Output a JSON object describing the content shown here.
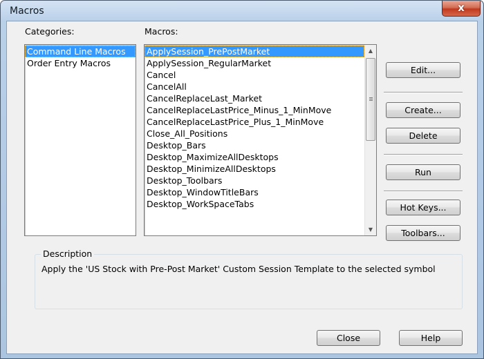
{
  "window": {
    "title": "Macros",
    "close_glyph": "x"
  },
  "categories": {
    "label": "Categories:",
    "items": [
      "Command Line Macros",
      "Order Entry Macros"
    ],
    "selected_index": 0
  },
  "macros": {
    "label": "Macros:",
    "items": [
      "ApplySession_PrePostMarket",
      "ApplySession_RegularMarket",
      "Cancel",
      "CancelAll",
      "CancelReplaceLast_Market",
      "CancelReplaceLastPrice_Minus_1_MinMove",
      "CancelReplaceLastPrice_Plus_1_MinMove",
      "Close_All_Positions",
      "Desktop_Bars",
      "Desktop_MaximizeAllDesktops",
      "Desktop_MinimizeAllDesktops",
      "Desktop_Toolbars",
      "Desktop_WindowTitleBars",
      "Desktop_WorkSpaceTabs"
    ],
    "selected_index": 0
  },
  "side_buttons": {
    "edit": "Edit...",
    "create": "Create...",
    "delete": "Delete",
    "run": "Run",
    "hot_keys": "Hot Keys...",
    "toolbars": "Toolbars..."
  },
  "description": {
    "label": "Description",
    "text": "Apply the 'US Stock with Pre-Post Market' Custom Session Template to the selected symbol"
  },
  "footer": {
    "close": "Close",
    "help": "Help"
  },
  "colors": {
    "selection": "#3399ff",
    "close_button": "#c1391f",
    "dialog_bg": "#f0f0f0"
  }
}
